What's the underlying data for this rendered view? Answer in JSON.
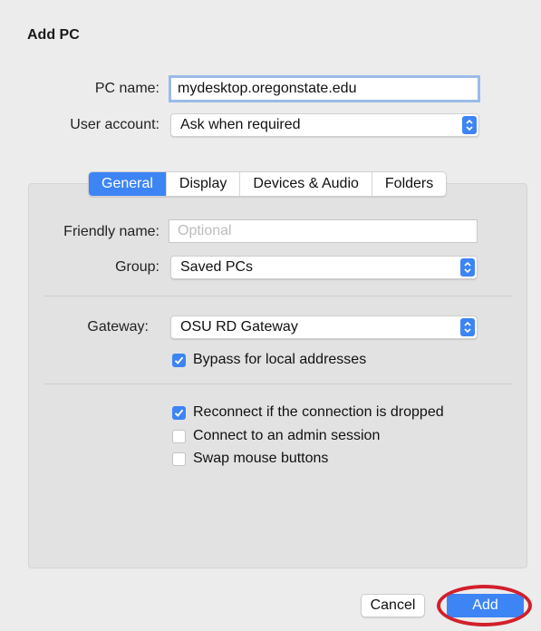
{
  "window": {
    "title": "Add PC"
  },
  "pc_name": {
    "label": "PC name:",
    "value": "mydesktop.oregonstate.edu"
  },
  "user_account": {
    "label": "User account:",
    "value": "Ask when required"
  },
  "tabs": [
    {
      "label": "General",
      "selected": true
    },
    {
      "label": "Display",
      "selected": false
    },
    {
      "label": "Devices & Audio",
      "selected": false
    },
    {
      "label": "Folders",
      "selected": false
    }
  ],
  "general": {
    "friendly_name": {
      "label": "Friendly name:",
      "placeholder": "Optional"
    },
    "group": {
      "label": "Group:",
      "value": "Saved PCs"
    },
    "gateway": {
      "label": "Gateway:",
      "value": "OSU RD Gateway"
    },
    "bypass": {
      "label": "Bypass for local addresses",
      "checked": true
    },
    "reconnect": {
      "label": "Reconnect if the connection is dropped",
      "checked": true
    },
    "admin_session": {
      "label": "Connect to an admin session",
      "checked": false
    },
    "swap_mouse": {
      "label": "Swap mouse buttons",
      "checked": false
    }
  },
  "buttons": {
    "cancel": "Cancel",
    "add": "Add"
  },
  "colors": {
    "accent": "#3d84f5",
    "annotation_ring": "#d2202c",
    "background": "#ececec"
  }
}
